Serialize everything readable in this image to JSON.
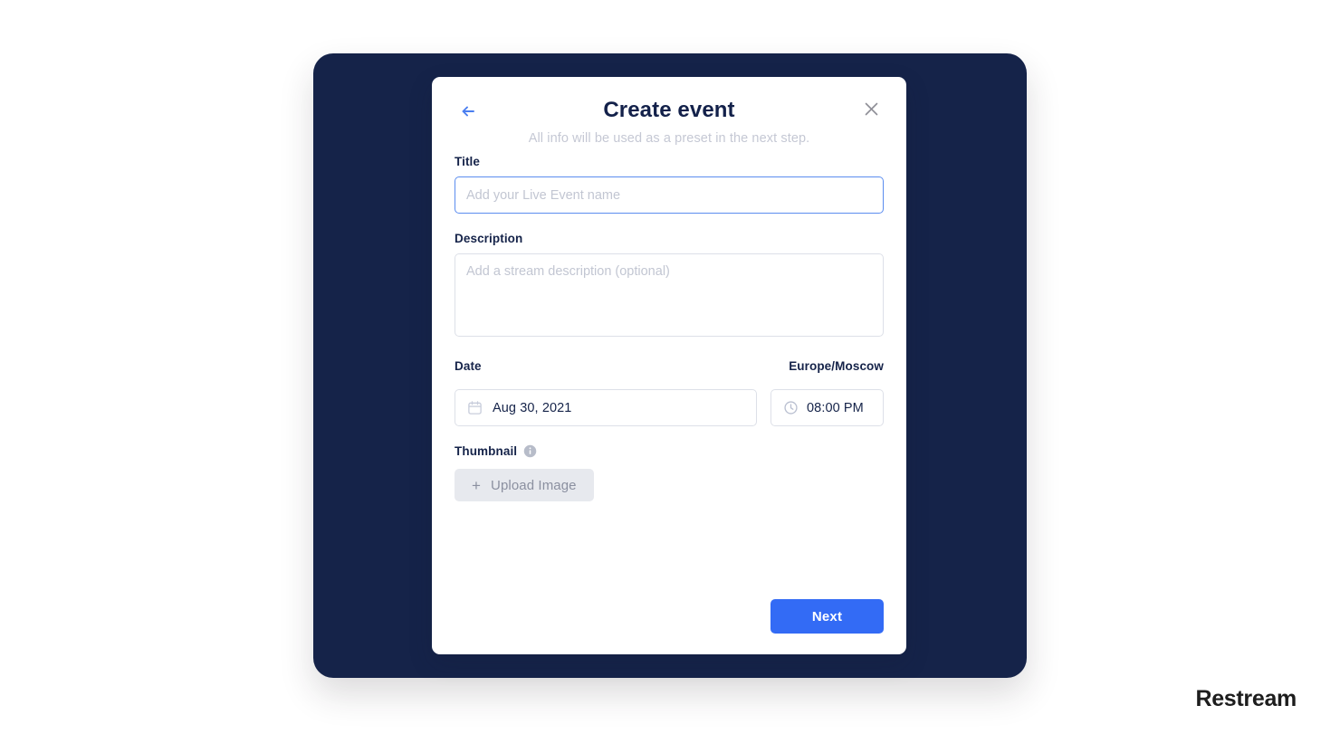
{
  "brand": {
    "name": "Restream"
  },
  "colors": {
    "stage_bg": "#152349",
    "accent_blue": "#336bf5",
    "focus_border": "#5b8def",
    "text_navy": "#152349",
    "muted_gray": "#c5c8d4",
    "upload_bg": "#e7e9ee"
  },
  "modal": {
    "title": "Create event",
    "subtitle": "All info will be used as a preset in the next step.",
    "back_icon": "arrow-left-icon",
    "close_icon": "close-icon",
    "fields": {
      "title": {
        "label": "Title",
        "value": "",
        "placeholder": "Add your Live Event name",
        "focused": true
      },
      "description": {
        "label": "Description",
        "value": "",
        "placeholder": "Add a stream description (optional)"
      },
      "date": {
        "label": "Date",
        "value": "Aug 30, 2021",
        "icon": "calendar-icon"
      },
      "time": {
        "label": "Europe/Moscow",
        "value": "08:00 PM",
        "icon": "clock-icon"
      },
      "thumbnail": {
        "label": "Thumbnail",
        "info_icon": "info-icon",
        "upload_plus": "+",
        "upload_label": "Upload Image"
      }
    },
    "footer": {
      "next_label": "Next"
    }
  }
}
